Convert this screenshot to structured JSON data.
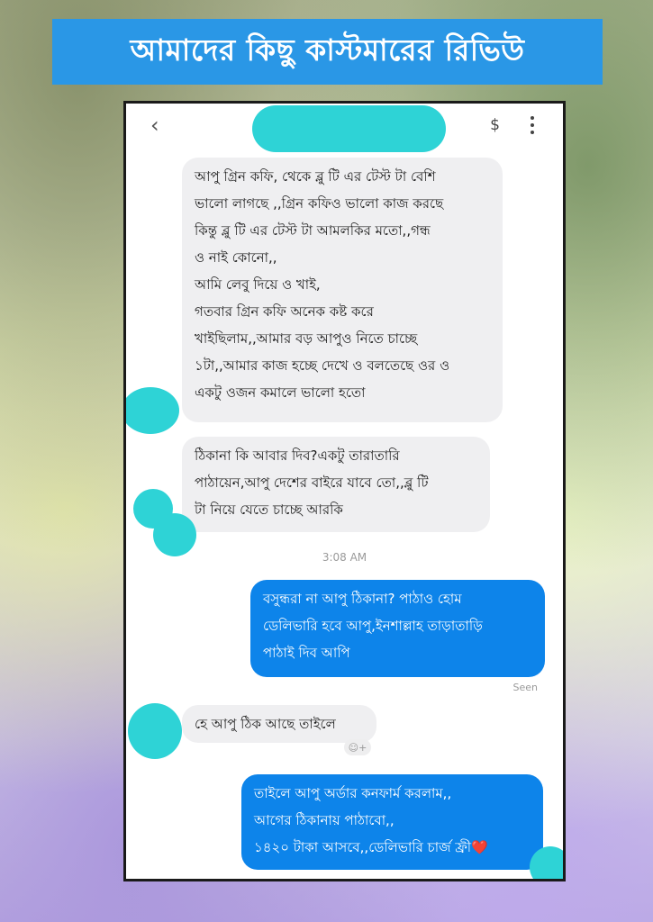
{
  "banner": {
    "title": "আমাদের কিছু কাস্টমারের রিভিউ"
  },
  "header": {
    "back_icon": "chevron-left-icon",
    "dollar_label": "$",
    "menu_icon": "more-vertical-icon"
  },
  "messages": [
    {
      "direction": "incoming",
      "lines": [
        "আপু গ্রিন কফি, থেকে ব্লু টি এর টেস্ট টা বেশি",
        "ভালো লাগছে ,,গ্রিন কফিও ভালো কাজ করছে",
        "কিন্তু ব্লু টি এর টেস্ট টা আমলকির মতো,,গন্ধ",
        "ও নাই কোনো,,",
        "আমি লেবু দিয়ে ও খাই,",
        "গতবার গ্রিন কফি অনেক কষ্ট করে",
        "খাইছিলাম,,আমার বড় আপুও নিতে চাচ্ছে",
        "১টা,,আমার কাজ হচ্ছে দেখে ও বলতেছে ওর ও",
        "একটু ওজন কমালে ভালো হতো"
      ]
    },
    {
      "direction": "incoming",
      "lines": [
        "ঠিকানা কি আবার দিব?একটু তারাতারি",
        "পাঠায়েন,আপু দেশের বাইরে যাবে তো,,ব্লু টি",
        "টা নিয়ে যেতে চাচ্ছে আরকি"
      ]
    },
    {
      "direction": "outgoing",
      "lines": [
        "বসুন্ধরা না আপু ঠিকানা? পাঠাও হোম",
        "ডেলিভারি হবে আপু,ইনশাল্লাহ তাড়াতাড়ি",
        "পাঠাই দিব আপি"
      ]
    },
    {
      "direction": "incoming",
      "lines": [
        "হে আপু ঠিক আছে তাইলে"
      ]
    },
    {
      "direction": "outgoing",
      "lines": [
        "তাইলে আপু অর্ডার কনফার্ম করলাম,,",
        "আগের ঠিকানায় পাঠাবো,,",
        "১৪২০ টাকা আসবে,,ডেলিভারি চার্জ ফ্রী"
      ],
      "trailing_emoji": "❤️"
    }
  ],
  "timestamp": "3:08 AM",
  "seen_label": "Seen",
  "reaction_add": "☺+",
  "colors": {
    "banner": "#2a97e6",
    "outgoing_bubble": "#0d84ea",
    "incoming_bubble": "#efeff1",
    "redaction": "#2ed3d6"
  }
}
